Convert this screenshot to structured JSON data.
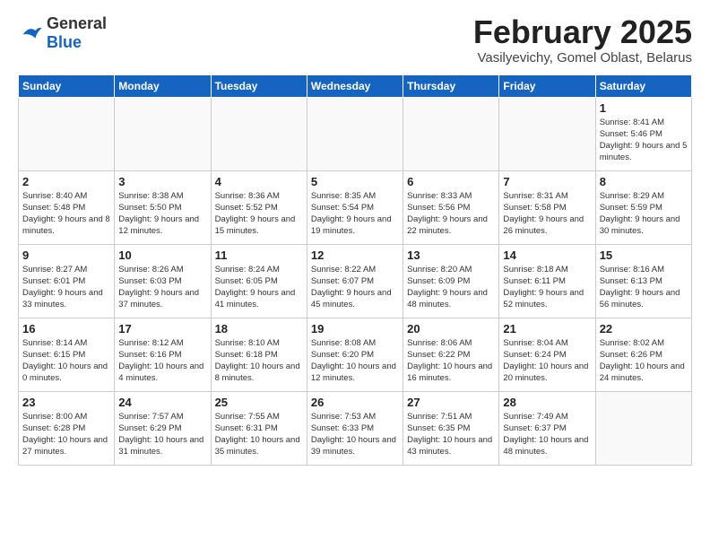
{
  "header": {
    "logo_general": "General",
    "logo_blue": "Blue",
    "month_title": "February 2025",
    "location": "Vasilyevichy, Gomel Oblast, Belarus"
  },
  "weekdays": [
    "Sunday",
    "Monday",
    "Tuesday",
    "Wednesday",
    "Thursday",
    "Friday",
    "Saturday"
  ],
  "weeks": [
    [
      {
        "day": "",
        "info": ""
      },
      {
        "day": "",
        "info": ""
      },
      {
        "day": "",
        "info": ""
      },
      {
        "day": "",
        "info": ""
      },
      {
        "day": "",
        "info": ""
      },
      {
        "day": "",
        "info": ""
      },
      {
        "day": "1",
        "info": "Sunrise: 8:41 AM\nSunset: 5:46 PM\nDaylight: 9 hours and 5 minutes."
      }
    ],
    [
      {
        "day": "2",
        "info": "Sunrise: 8:40 AM\nSunset: 5:48 PM\nDaylight: 9 hours and 8 minutes."
      },
      {
        "day": "3",
        "info": "Sunrise: 8:38 AM\nSunset: 5:50 PM\nDaylight: 9 hours and 12 minutes."
      },
      {
        "day": "4",
        "info": "Sunrise: 8:36 AM\nSunset: 5:52 PM\nDaylight: 9 hours and 15 minutes."
      },
      {
        "day": "5",
        "info": "Sunrise: 8:35 AM\nSunset: 5:54 PM\nDaylight: 9 hours and 19 minutes."
      },
      {
        "day": "6",
        "info": "Sunrise: 8:33 AM\nSunset: 5:56 PM\nDaylight: 9 hours and 22 minutes."
      },
      {
        "day": "7",
        "info": "Sunrise: 8:31 AM\nSunset: 5:58 PM\nDaylight: 9 hours and 26 minutes."
      },
      {
        "day": "8",
        "info": "Sunrise: 8:29 AM\nSunset: 5:59 PM\nDaylight: 9 hours and 30 minutes."
      }
    ],
    [
      {
        "day": "9",
        "info": "Sunrise: 8:27 AM\nSunset: 6:01 PM\nDaylight: 9 hours and 33 minutes."
      },
      {
        "day": "10",
        "info": "Sunrise: 8:26 AM\nSunset: 6:03 PM\nDaylight: 9 hours and 37 minutes."
      },
      {
        "day": "11",
        "info": "Sunrise: 8:24 AM\nSunset: 6:05 PM\nDaylight: 9 hours and 41 minutes."
      },
      {
        "day": "12",
        "info": "Sunrise: 8:22 AM\nSunset: 6:07 PM\nDaylight: 9 hours and 45 minutes."
      },
      {
        "day": "13",
        "info": "Sunrise: 8:20 AM\nSunset: 6:09 PM\nDaylight: 9 hours and 48 minutes."
      },
      {
        "day": "14",
        "info": "Sunrise: 8:18 AM\nSunset: 6:11 PM\nDaylight: 9 hours and 52 minutes."
      },
      {
        "day": "15",
        "info": "Sunrise: 8:16 AM\nSunset: 6:13 PM\nDaylight: 9 hours and 56 minutes."
      }
    ],
    [
      {
        "day": "16",
        "info": "Sunrise: 8:14 AM\nSunset: 6:15 PM\nDaylight: 10 hours and 0 minutes."
      },
      {
        "day": "17",
        "info": "Sunrise: 8:12 AM\nSunset: 6:16 PM\nDaylight: 10 hours and 4 minutes."
      },
      {
        "day": "18",
        "info": "Sunrise: 8:10 AM\nSunset: 6:18 PM\nDaylight: 10 hours and 8 minutes."
      },
      {
        "day": "19",
        "info": "Sunrise: 8:08 AM\nSunset: 6:20 PM\nDaylight: 10 hours and 12 minutes."
      },
      {
        "day": "20",
        "info": "Sunrise: 8:06 AM\nSunset: 6:22 PM\nDaylight: 10 hours and 16 minutes."
      },
      {
        "day": "21",
        "info": "Sunrise: 8:04 AM\nSunset: 6:24 PM\nDaylight: 10 hours and 20 minutes."
      },
      {
        "day": "22",
        "info": "Sunrise: 8:02 AM\nSunset: 6:26 PM\nDaylight: 10 hours and 24 minutes."
      }
    ],
    [
      {
        "day": "23",
        "info": "Sunrise: 8:00 AM\nSunset: 6:28 PM\nDaylight: 10 hours and 27 minutes."
      },
      {
        "day": "24",
        "info": "Sunrise: 7:57 AM\nSunset: 6:29 PM\nDaylight: 10 hours and 31 minutes."
      },
      {
        "day": "25",
        "info": "Sunrise: 7:55 AM\nSunset: 6:31 PM\nDaylight: 10 hours and 35 minutes."
      },
      {
        "day": "26",
        "info": "Sunrise: 7:53 AM\nSunset: 6:33 PM\nDaylight: 10 hours and 39 minutes."
      },
      {
        "day": "27",
        "info": "Sunrise: 7:51 AM\nSunset: 6:35 PM\nDaylight: 10 hours and 43 minutes."
      },
      {
        "day": "28",
        "info": "Sunrise: 7:49 AM\nSunset: 6:37 PM\nDaylight: 10 hours and 48 minutes."
      },
      {
        "day": "",
        "info": ""
      }
    ]
  ]
}
